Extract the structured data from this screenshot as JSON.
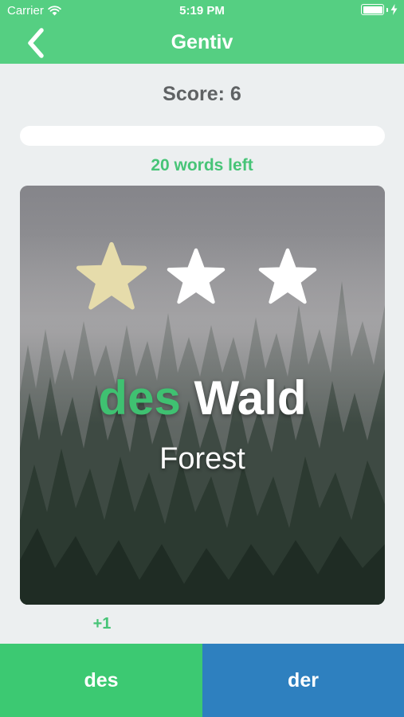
{
  "status_bar": {
    "carrier": "Carrier",
    "time": "5:19 PM",
    "icons": [
      "wifi-icon",
      "battery-icon",
      "charging-bolt-icon"
    ]
  },
  "nav": {
    "title": "Gentiv",
    "back_icon": "chevron-left-icon"
  },
  "quiz": {
    "score": "Score: 6",
    "progress": 0,
    "words_left": "20 words left"
  },
  "card": {
    "article": "des",
    "noun": "Wald",
    "translation": "Forest",
    "stars_total": 3,
    "stars_earned": 1,
    "background": "foggy-forest-image"
  },
  "feedback": {
    "points": "+1"
  },
  "answers": [
    {
      "label": "des"
    },
    {
      "label": "der"
    }
  ],
  "colors": {
    "header": "#55cf82",
    "accent_green": "#3fc171",
    "answer_left": "#3cc972",
    "answer_right": "#2e80bf",
    "star_earned": "#e6dcab",
    "star_empty": "#ffffff",
    "background": "#eceff0"
  }
}
